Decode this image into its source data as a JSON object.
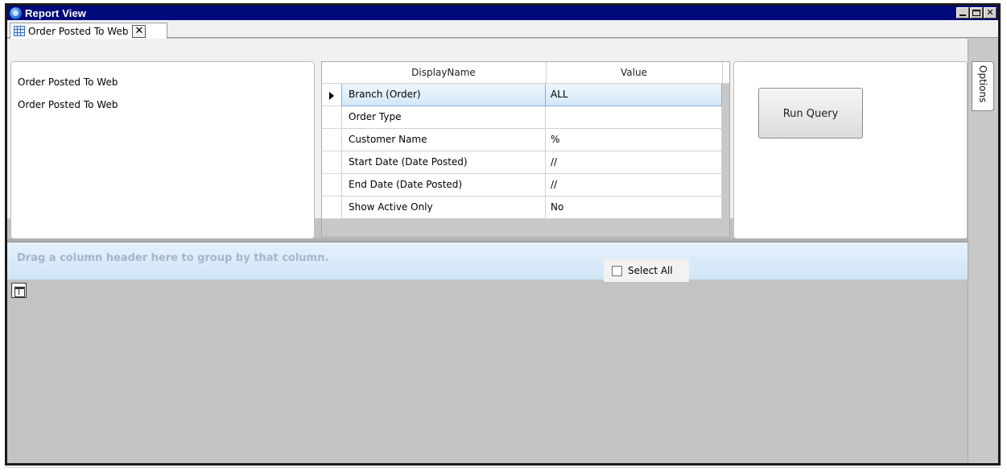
{
  "window": {
    "title": "Report View",
    "controls": [
      "minimize",
      "maximize",
      "close"
    ]
  },
  "tabs": [
    {
      "label": "Order Posted To Web",
      "icon": "grid-icon",
      "active": true
    }
  ],
  "left_panel": {
    "items": [
      "Order Posted To Web",
      "Order Posted To Web"
    ]
  },
  "parameters": {
    "columns": [
      "DisplayName",
      "Value"
    ],
    "rows": [
      {
        "name": "Branch (Order)",
        "value": "ALL",
        "selected": true
      },
      {
        "name": "Order Type",
        "value": ""
      },
      {
        "name": "Customer Name",
        "value": "%"
      },
      {
        "name": "Start Date (Date Posted)",
        "value": "//"
      },
      {
        "name": "End Date (Date Posted)",
        "value": "//"
      },
      {
        "name": "Show Active Only",
        "value": "No"
      }
    ]
  },
  "run_button": {
    "label": "Run Query"
  },
  "group_bar": {
    "hint": "Drag a column header here to group by that column."
  },
  "select_all": {
    "label": "Select All",
    "checked": false
  },
  "side_panel": {
    "options_label": "Options"
  },
  "colors": {
    "titlebar": "#000a7a",
    "groupbar": "#d7e9f7",
    "active_row": "#d4e8f8"
  }
}
